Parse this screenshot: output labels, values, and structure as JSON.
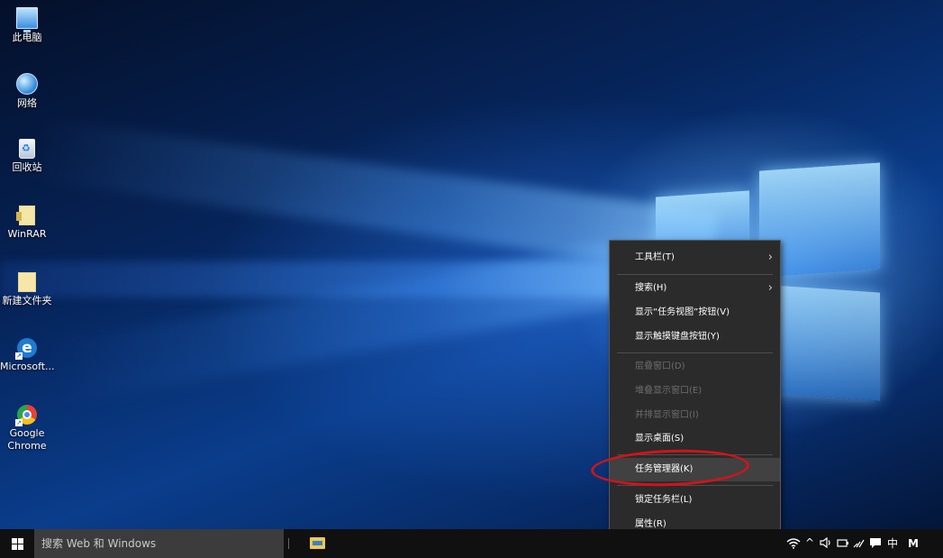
{
  "desktop": {
    "icons": [
      {
        "label": "此电脑",
        "icon": "this-pc-icon"
      },
      {
        "label": "网络",
        "icon": "network-icon"
      },
      {
        "label": "回收站",
        "icon": "recycle-bin-icon"
      },
      {
        "label": "WinRAR",
        "icon": "winrar-icon"
      },
      {
        "label": "新建文件夹",
        "icon": "folder-icon"
      },
      {
        "label": "Microsoft...",
        "icon": "edge-icon"
      },
      {
        "label": "Google Chrome",
        "icon": "chrome-icon"
      }
    ]
  },
  "context_menu": {
    "items": [
      {
        "label": "工具栏(T)",
        "enabled": true,
        "submenu": true
      },
      {
        "label": "搜索(H)",
        "enabled": true,
        "submenu": true
      },
      {
        "label": "显示“任务视图”按钮(V)",
        "enabled": true
      },
      {
        "label": "显示触摸键盘按钮(Y)",
        "enabled": true
      },
      {
        "label": "层叠窗口(D)",
        "enabled": false
      },
      {
        "label": "堆叠显示窗口(E)",
        "enabled": false
      },
      {
        "label": "并排显示窗口(I)",
        "enabled": false
      },
      {
        "label": "显示桌面(S)",
        "enabled": true
      },
      {
        "label": "任务管理器(K)",
        "enabled": true,
        "highlighted": true
      },
      {
        "label": "锁定任务栏(L)",
        "enabled": true
      },
      {
        "label": "属性(R)",
        "enabled": true
      }
    ],
    "annotation_color": "#d0141b",
    "submenu_arrow": "›"
  },
  "taskbar": {
    "search_placeholder": "搜索 Web 和 Windows",
    "pinned": [
      {
        "icon": "file-explorer-icon"
      }
    ],
    "tray": {
      "wifi": "wifi-icon",
      "chevron": "^",
      "volume": "volume-icon",
      "ime": "中",
      "ime2": "M"
    }
  }
}
